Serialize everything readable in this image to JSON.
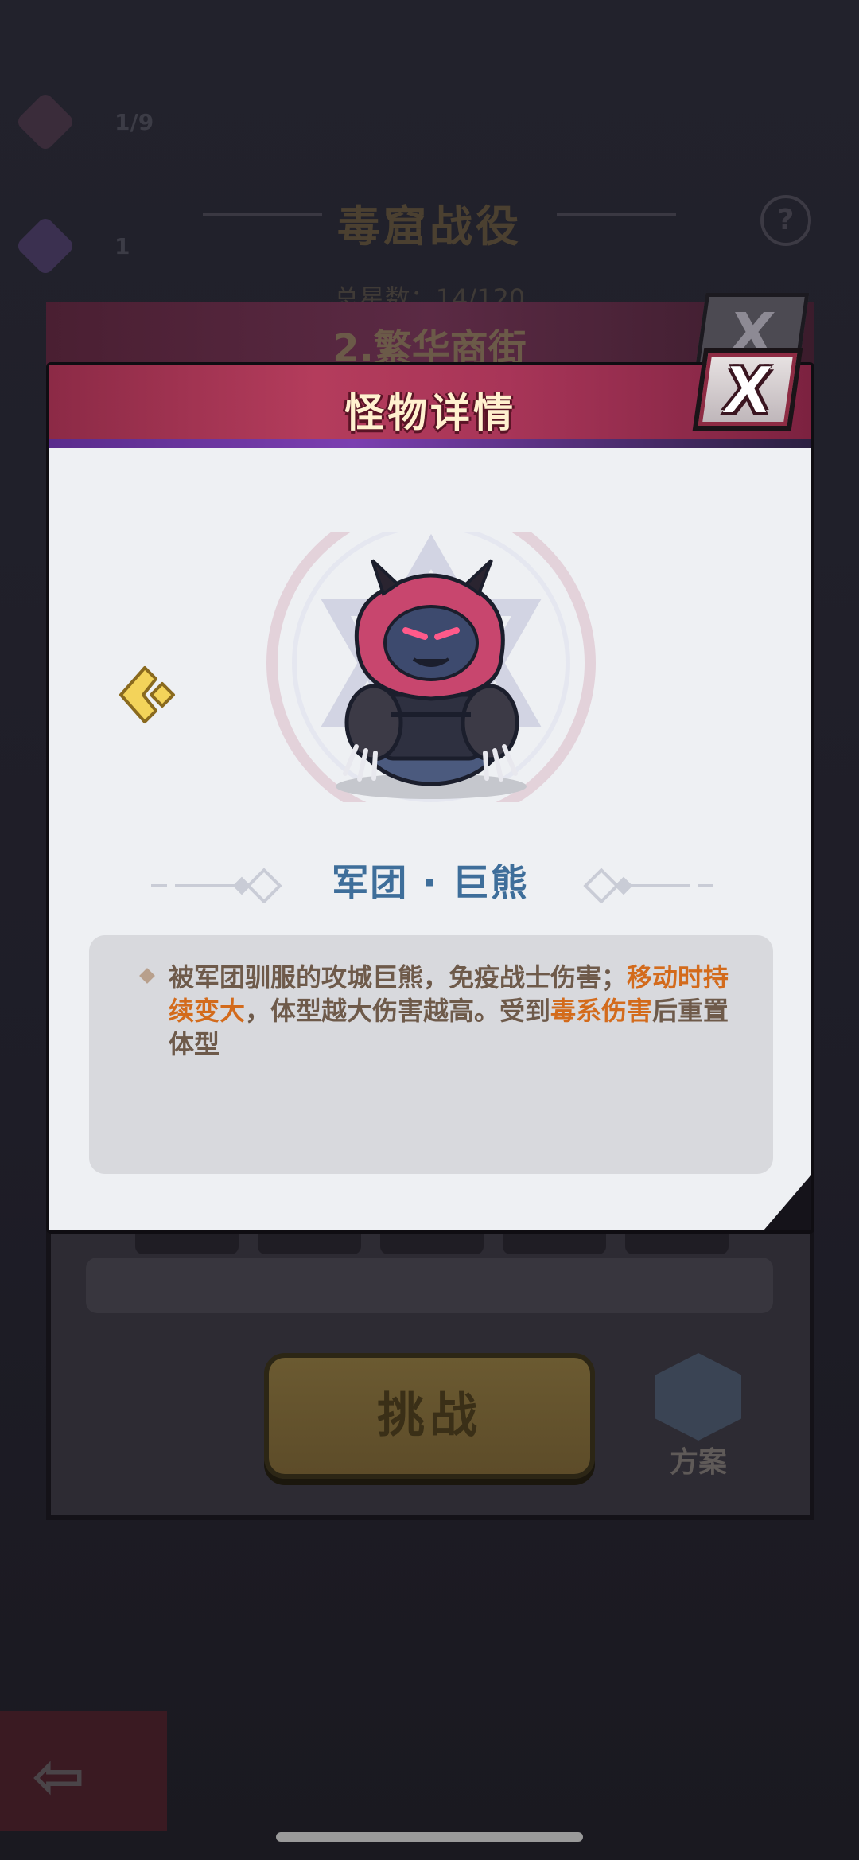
{
  "background": {
    "resources": [
      {
        "icon": "ticket-icon",
        "value": "1/9"
      },
      {
        "icon": "card-plus-icon",
        "value": "1"
      }
    ],
    "event_title": "毒窟战役",
    "progress_text": "总星数：14/120",
    "stage_title": "2.繁华商街",
    "challenge_label": "挑战",
    "plan_label": "方案"
  },
  "modal": {
    "title": "怪物详情",
    "monster_name": "军团 · 巨熊",
    "description": {
      "part1": "被军团驯服的攻城巨熊，免疫战士伤害；",
      "highlight1": "移动时持续变大",
      "part2": "，体型越大伤害越高。受到",
      "highlight2": "毒系伤害",
      "part3": "后重置体型"
    }
  },
  "colors": {
    "header": "#b43c5c",
    "name_blue": "#3e6e9a",
    "highlight_orange": "#d36b1c",
    "arrow_yellow": "#f3d35a"
  }
}
